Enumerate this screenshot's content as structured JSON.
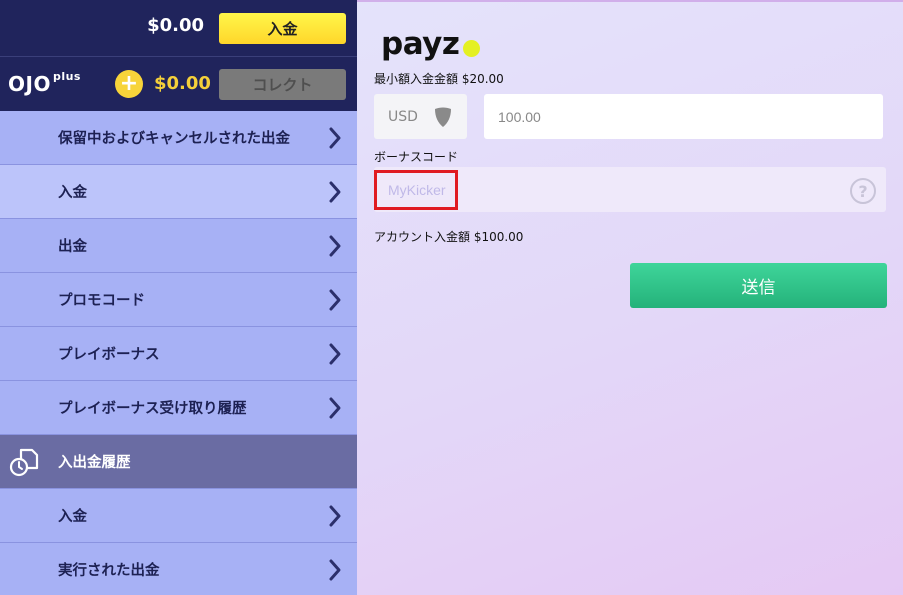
{
  "header": {
    "balance": "$0.00",
    "deposit_button": "入金"
  },
  "ojo_plus": {
    "logo": "OJO",
    "logo_sup": "plus",
    "coin_symbol": "+",
    "amount": "$0.00",
    "collect_button": "コレクト"
  },
  "menu": {
    "items": [
      {
        "label": "保留中およびキャンセルされた出金"
      },
      {
        "label": "入金"
      },
      {
        "label": "出金"
      },
      {
        "label": "プロモコード"
      },
      {
        "label": "プレイボーナス"
      },
      {
        "label": "プレイボーナス受け取り履歴"
      }
    ],
    "section": {
      "label": "入出金履歴",
      "icon": "history-document-icon"
    },
    "history_items": [
      {
        "label": "入金"
      },
      {
        "label": "実行された出金"
      }
    ]
  },
  "payment": {
    "brand": "payz",
    "min_deposit": "最小額入金金額 $20.00",
    "currency": "USD",
    "amount_value": "100.00",
    "bonus_label": "ボーナスコード",
    "bonus_placeholder": "MyKicker",
    "help_symbol": "?",
    "account_amount": "アカウント入金額  $100.00",
    "submit_button": "送信"
  },
  "colors": {
    "header_bg": "#20245c",
    "deposit_yellow": "#ffd62a",
    "menu_bg": "#a7b1f5",
    "section_bg": "#6a6ca3",
    "submit_green": "#2fc48a",
    "highlight_red": "#e01b22"
  }
}
